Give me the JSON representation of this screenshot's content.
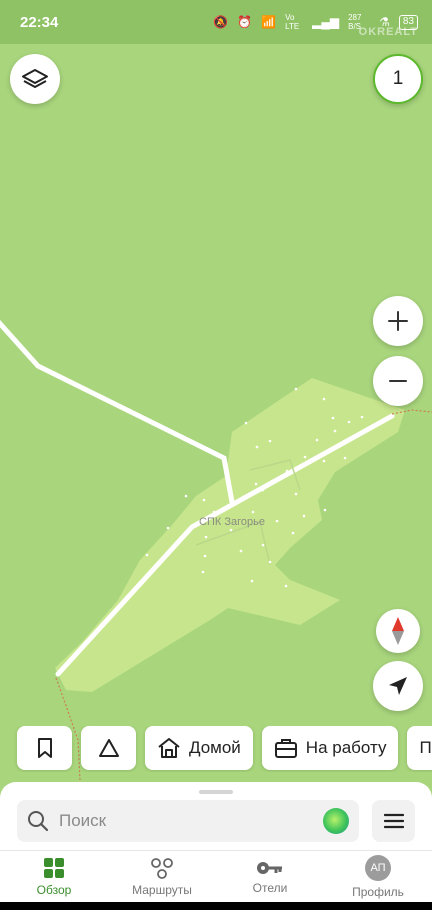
{
  "status": {
    "time": "22:34",
    "network_a": "Vo LTE",
    "network_speed": "287 B/S",
    "battery": "83",
    "watermark": "OKREALT"
  },
  "map": {
    "settlement_label": "СПК Загорье",
    "counter_badge": "1"
  },
  "chips": {
    "home_label": "Домой",
    "work_label": "На работу",
    "more_label": "По"
  },
  "search": {
    "placeholder": "Поиск"
  },
  "tabs": [
    {
      "label": "Обзор"
    },
    {
      "label": "Маршруты"
    },
    {
      "label": "Отели"
    },
    {
      "label": "Профиль"
    }
  ],
  "profile": {
    "avatar_initials": "АП"
  },
  "colors": {
    "map_bg": "#a9d67d",
    "settlement_area": "#c7e58c",
    "accent": "#3a8e2b"
  }
}
